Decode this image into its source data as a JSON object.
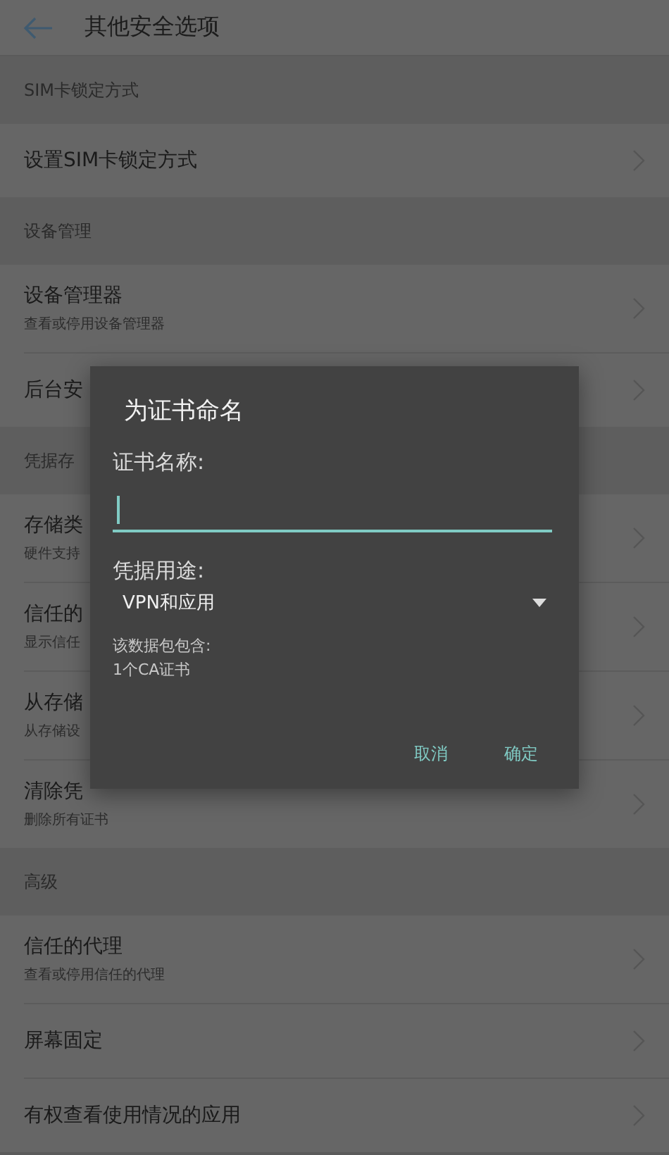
{
  "header": {
    "title": "其他安全选项"
  },
  "sections": [
    {
      "label": "SIM卡锁定方式",
      "items": [
        {
          "title": "设置SIM卡锁定方式"
        }
      ]
    },
    {
      "label": "设备管理",
      "items": [
        {
          "title": "设备管理器",
          "subtitle": "查看或停用设备管理器"
        },
        {
          "title": "后台安"
        }
      ]
    },
    {
      "label": "凭据存",
      "items": [
        {
          "title": "存储类",
          "subtitle": "硬件支持"
        },
        {
          "title": "信任的",
          "subtitle": "显示信任"
        },
        {
          "title": "从存储",
          "subtitle": "从存储设"
        },
        {
          "title": "清除凭",
          "subtitle": "删除所有证书"
        }
      ]
    },
    {
      "label": "高级",
      "items": [
        {
          "title": "信任的代理",
          "subtitle": "查看或停用信任的代理"
        },
        {
          "title": "屏幕固定"
        },
        {
          "title": "有权查看使用情况的应用"
        }
      ]
    }
  ],
  "dialog": {
    "title": "为证书命名",
    "name_label": "证书名称:",
    "usage_label": "凭据用途:",
    "usage_value": "VPN和应用",
    "info": [
      "该数据包包含:",
      "1个CA证书"
    ],
    "buttons": [
      "取消",
      "确定"
    ]
  }
}
